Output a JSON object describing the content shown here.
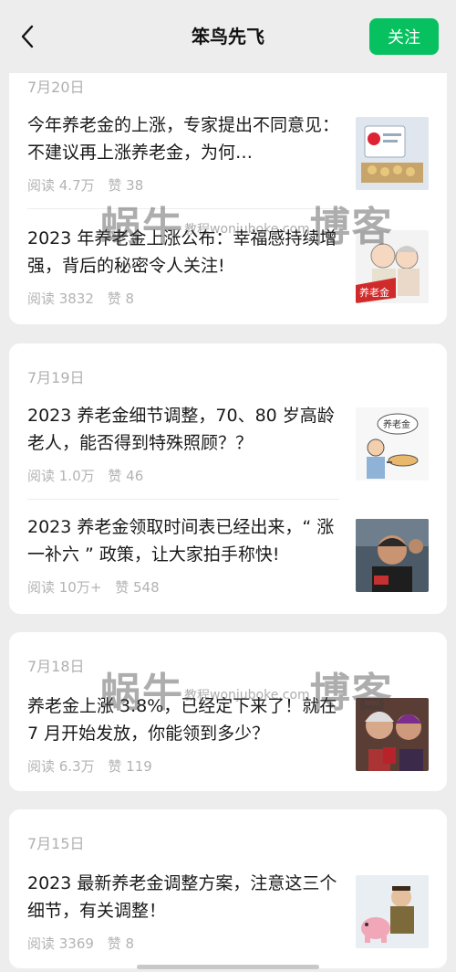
{
  "header": {
    "title": "笨鸟先飞",
    "follow_label": "关注",
    "accent_color": "#07c160"
  },
  "groups": [
    {
      "date": "7月20日",
      "articles": [
        {
          "title": "今年养老金的上涨，专家提出不同意见：不建议再上涨养老金，为何…",
          "reads": "阅读 4.7万",
          "likes": "赞 38"
        },
        {
          "title": "2023 年养老金上涨公布：幸福感持续增强，背后的秘密令人关注!",
          "reads": "阅读 3832",
          "likes": "赞 8",
          "thumb_label": "养老金"
        }
      ]
    },
    {
      "date": "7月19日",
      "articles": [
        {
          "title": "2023 养老金细节调整，70、80 岁高龄老人，能否得到特殊照顾？？",
          "reads": "阅读 1.0万",
          "likes": "赞 46",
          "thumb_label": "养老金"
        },
        {
          "title": "2023 养老金领取时间表已经出来，“ 涨一补六 ” 政策，让大家拍手称快!",
          "reads": "阅读 10万+",
          "likes": "赞 548"
        }
      ]
    },
    {
      "date": "7月18日",
      "articles": [
        {
          "title": "养老金上涨 3.8%，已经定下来了！就在 7 月开始发放，你能领到多少？",
          "reads": "阅读 6.3万",
          "likes": "赞 119"
        }
      ]
    },
    {
      "date": "7月15日",
      "articles": [
        {
          "title": "2023 最新养老金调整方案，注意这三个细节，有关调整！",
          "reads": "阅读 3369",
          "likes": "赞 8"
        }
      ]
    }
  ],
  "watermark": {
    "text_left": "蜗牛",
    "text_mid": "教程",
    "text_right": "博客",
    "url": "wonjuboke.com"
  }
}
